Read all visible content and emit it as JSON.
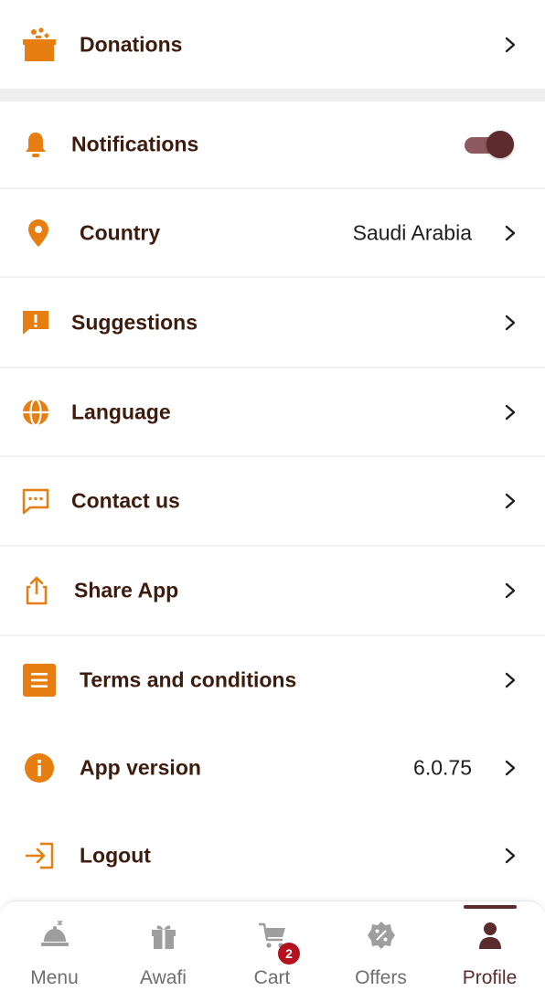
{
  "settings": {
    "donations": {
      "label": "Donations",
      "icon": "donation-box-icon"
    },
    "notifications": {
      "label": "Notifications",
      "icon": "bell-icon",
      "enabled": true
    },
    "country": {
      "label": "Country",
      "value": "Saudi Arabia",
      "icon": "location-pin-icon"
    },
    "suggestions": {
      "label": "Suggestions",
      "icon": "feedback-icon"
    },
    "language": {
      "label": "Language",
      "icon": "globe-icon"
    },
    "contact": {
      "label": "Contact us",
      "icon": "chat-icon"
    },
    "share": {
      "label": "Share App",
      "icon": "share-icon"
    },
    "terms": {
      "label": "Terms and conditions",
      "icon": "document-list-icon"
    },
    "version": {
      "label": "App version",
      "value": "6.0.75",
      "icon": "info-icon"
    },
    "logout": {
      "label": "Logout",
      "icon": "logout-icon"
    }
  },
  "tabs": [
    {
      "label": "Menu",
      "icon": "cloche-icon"
    },
    {
      "label": "Awafi",
      "icon": "gift-icon"
    },
    {
      "label": "Cart",
      "icon": "cart-icon",
      "badge": "2"
    },
    {
      "label": "Offers",
      "icon": "percent-badge-icon"
    },
    {
      "label": "Profile",
      "icon": "person-icon",
      "active": true
    }
  ],
  "colors": {
    "accent": "#e67e12",
    "text": "#3d1c0e",
    "active_tab": "#5b2b2e",
    "toggle_track": "#8d5b5f",
    "badge": "#b3121e"
  }
}
